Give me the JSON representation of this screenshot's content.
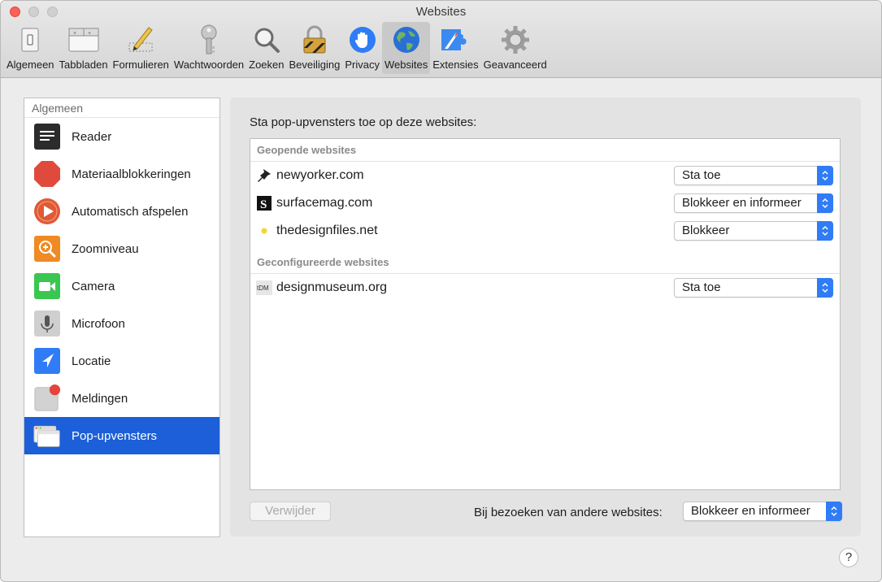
{
  "window": {
    "title": "Websites"
  },
  "toolbar": {
    "items": [
      {
        "label": "Algemeen",
        "icon": "switch-icon"
      },
      {
        "label": "Tabbladen",
        "icon": "tabs-icon"
      },
      {
        "label": "Formulieren",
        "icon": "pencil-form-icon"
      },
      {
        "label": "Wachtwoorden",
        "icon": "key-icon"
      },
      {
        "label": "Zoeken",
        "icon": "magnifier-icon"
      },
      {
        "label": "Beveiliging",
        "icon": "lock-icon"
      },
      {
        "label": "Privacy",
        "icon": "hand-icon"
      },
      {
        "label": "Websites",
        "icon": "globe-icon",
        "active": true
      },
      {
        "label": "Extensies",
        "icon": "puzzle-icon"
      },
      {
        "label": "Geavanceerd",
        "icon": "gear-icon"
      }
    ]
  },
  "sidebar": {
    "header": "Algemeen",
    "items": [
      {
        "label": "Reader",
        "icon": "reader-icon"
      },
      {
        "label": "Materiaalblokkeringen",
        "icon": "stop-sign-icon"
      },
      {
        "label": "Automatisch afspelen",
        "icon": "play-icon"
      },
      {
        "label": "Zoomniveau",
        "icon": "zoom-icon"
      },
      {
        "label": "Camera",
        "icon": "camera-icon"
      },
      {
        "label": "Microfoon",
        "icon": "microphone-icon"
      },
      {
        "label": "Locatie",
        "icon": "location-icon"
      },
      {
        "label": "Meldingen",
        "icon": "notifications-icon"
      },
      {
        "label": "Pop-upvensters",
        "icon": "popup-windows-icon",
        "selected": true
      }
    ]
  },
  "main": {
    "title": "Sta pop-upvensters toe op deze websites:",
    "open_header": "Geopende websites",
    "configured_header": "Geconfigureerde websites",
    "open_sites": [
      {
        "name": "newyorker.com",
        "setting": "Sta toe",
        "icon": "pushpin-favicon"
      },
      {
        "name": "surfacemag.com",
        "setting": "Blokkeer en informeer",
        "icon": "s-favicon"
      },
      {
        "name": "thedesignfiles.net",
        "setting": "Blokkeer",
        "icon": "dot-favicon"
      }
    ],
    "configured_sites": [
      {
        "name": "designmuseum.org",
        "setting": "Sta toe",
        "icon": "dm-favicon",
        "icon_text": "tDM"
      }
    ],
    "remove_button": "Verwijder",
    "other_label": "Bij bezoeken van andere websites:",
    "other_setting": "Blokkeer en informeer"
  },
  "help": "?",
  "colors": {
    "accent": "#1c5fd8",
    "popup_arrows": "#2f7cf6",
    "close": "#fc5f57"
  }
}
